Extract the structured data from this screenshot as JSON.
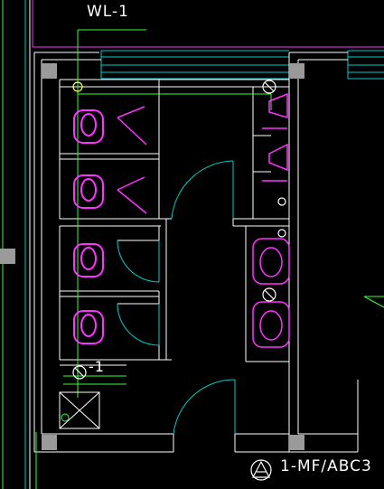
{
  "labels": {
    "top_pipe": "WL-1",
    "side_pipe": "-1",
    "section_marker": "1-MF/ABC3"
  },
  "colors": {
    "background": "#000000",
    "walls": "#ffffff",
    "fixtures": "#ff33ff",
    "plumbing": "#33ff33",
    "doors": "#00cccc",
    "columns": "#9a9a9a",
    "accent": "#ffff66"
  },
  "icons": {
    "squat_toilet": "squat-toilet-icon",
    "washbasin": "washbasin-icon",
    "urinal": "urinal-icon",
    "floor_drain": "floor-drain-icon",
    "section": "section-triangle-icon"
  }
}
